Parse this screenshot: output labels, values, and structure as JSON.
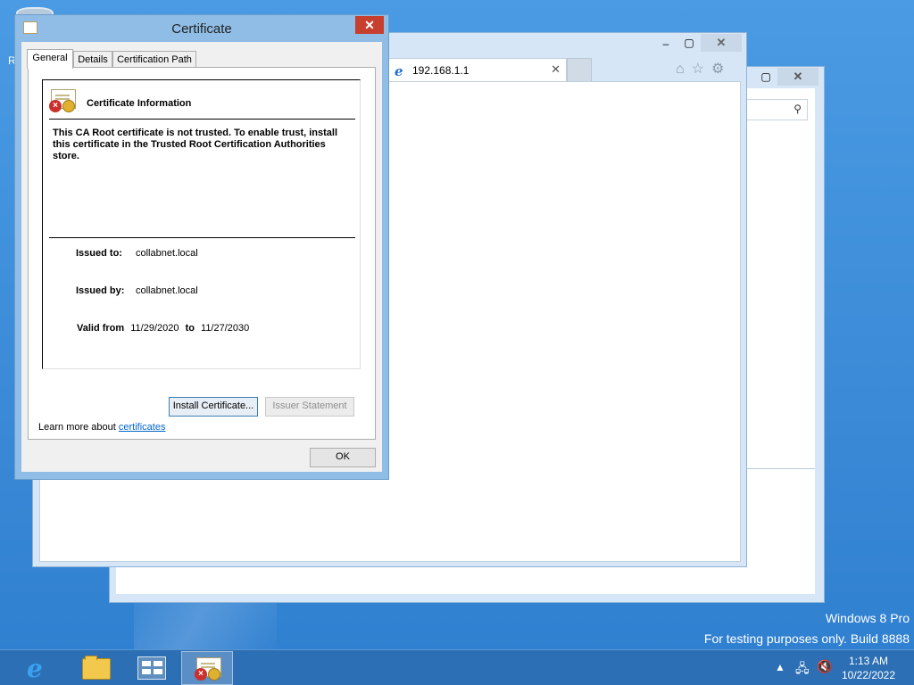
{
  "desktop": {
    "letter": "R",
    "watermark_line1": "Windows 8 Pro",
    "watermark_line2": "For testing purposes only. Build 8888"
  },
  "back_window": {
    "search_icon": "search-icon"
  },
  "ie_window": {
    "tab_title": "192.168.1.1",
    "tab_close": "✕",
    "tools": [
      "home-icon",
      "star-icon",
      "gear-icon"
    ]
  },
  "dialog": {
    "title": "Certificate",
    "close_glyph": "✕",
    "tabs": [
      "General",
      "Details",
      "Certification Path"
    ],
    "info_title": "Certificate Information",
    "warning": "This CA Root certificate is not trusted. To enable trust, install this certificate in the Trusted Root Certification Authorities store.",
    "issued_to_label": "Issued to:",
    "issued_to_value": "collabnet.local",
    "issued_by_label": "Issued by:",
    "issued_by_value": "collabnet.local",
    "valid_from_label": "Valid from",
    "valid_from_value": "11/29/2020",
    "valid_to_label": "to",
    "valid_to_value": "11/27/2030",
    "install_button": "Install Certificate...",
    "issuer_button": "Issuer Statement",
    "learn_more_text": "Learn more about",
    "learn_more_link": "certificates",
    "ok_button": "OK"
  },
  "taskbar": {
    "ie_glyph": "e",
    "clock_time": "1:13 AM",
    "clock_date": "10/22/2022",
    "tray_arrow": "▲"
  },
  "colors": {
    "desktop": "#3b8bd8",
    "close_red": "#c7402f",
    "link": "#0066cc"
  }
}
